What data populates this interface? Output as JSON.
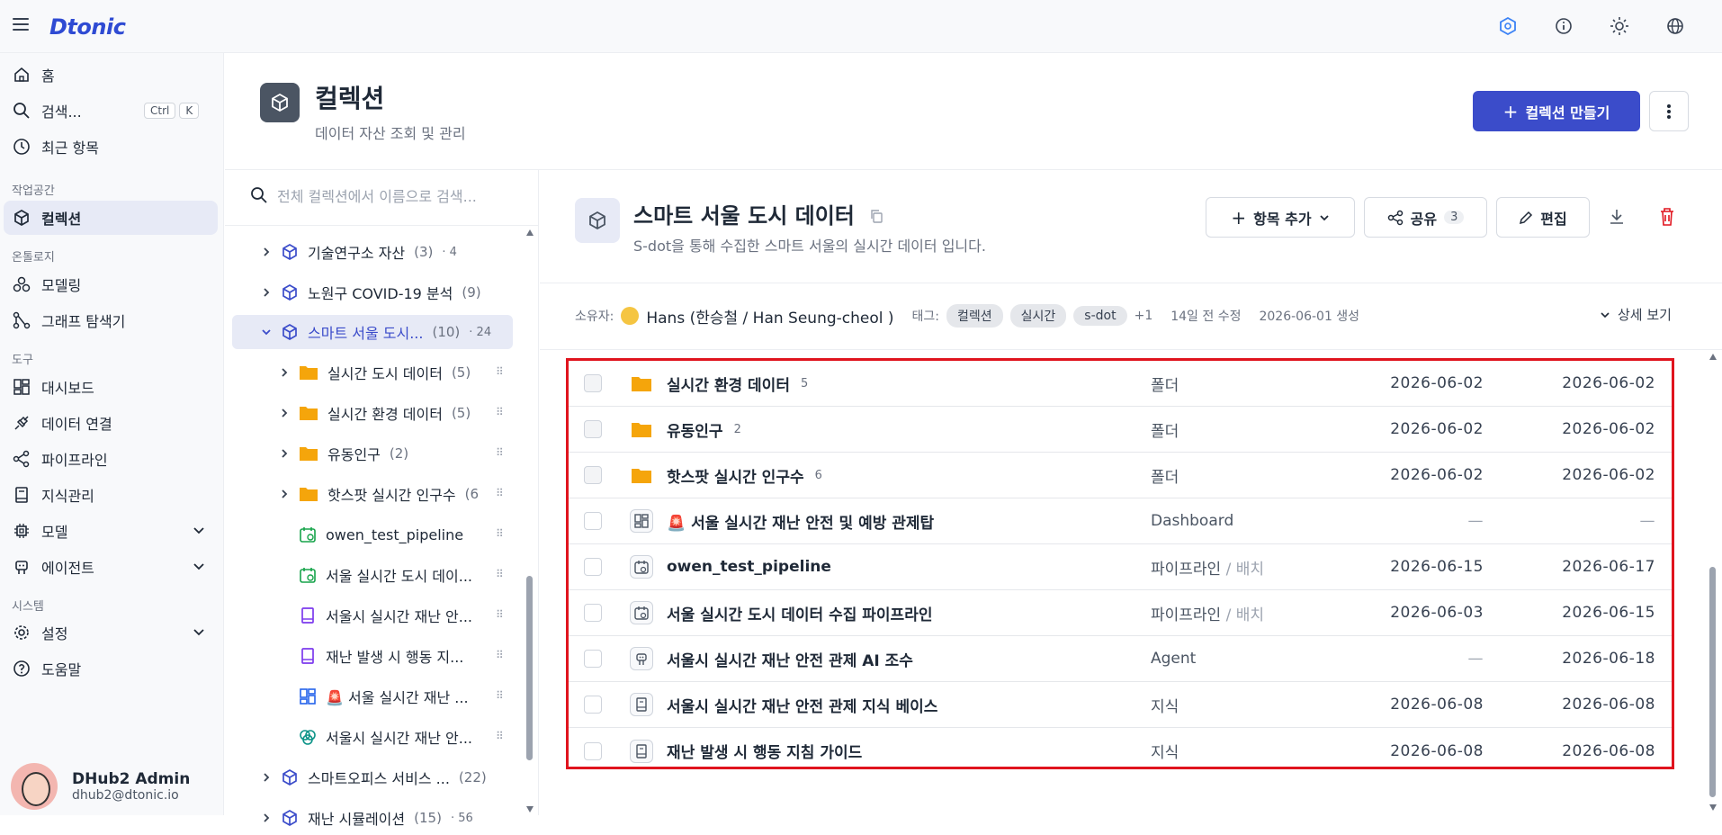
{
  "app": {
    "logo": "Dtonic"
  },
  "sidebar": {
    "home": "홈",
    "search": "검색...",
    "kbd_ctrl": "Ctrl",
    "kbd_k": "K",
    "recent": "최근 항목",
    "sections": {
      "workspace": "작업공간",
      "ontology": "온톨로지",
      "tools": "도구",
      "system": "시스템"
    },
    "collections": "컬렉션",
    "modeling": "모델링",
    "graph": "그래프 탐색기",
    "dashboard": "대시보드",
    "data_connect": "데이터 연결",
    "pipeline": "파이프라인",
    "knowledge": "지식관리",
    "model": "모델",
    "agent": "에이전트",
    "settings": "설정",
    "help": "도움말",
    "user": {
      "name": "DHub2 Admin",
      "email": "dhub2@dtonic.io"
    }
  },
  "header": {
    "title": "컬렉션",
    "subtitle": "데이터 자산 조회 및 관리",
    "create_button": "컬렉션 만들기"
  },
  "tree": {
    "search_placeholder": "전체 컬렉션에서 이름으로 검색...",
    "items": [
      {
        "label": "기술연구소 자산",
        "count": "(3)",
        "extra": "· 4"
      },
      {
        "label": "노원구 COVID-19 분석",
        "count": "(9)",
        "extra": ""
      },
      {
        "label": "스마트 서울 도시...",
        "count": "(10)",
        "extra": "· 24"
      },
      {
        "label": "실시간 도시 데이터",
        "count": "(5)"
      },
      {
        "label": "실시간 환경 데이터",
        "count": "(5)"
      },
      {
        "label": "유동인구",
        "count": "(2)"
      },
      {
        "label": "핫스팟 실시간 인구수",
        "count": "(6"
      },
      {
        "label": "owen_test_pipeline"
      },
      {
        "label": "서울 실시간 도시 데이..."
      },
      {
        "label": "서울시 실시간 재난 안..."
      },
      {
        "label": "재난 발생 시 행동 지..."
      },
      {
        "label": "🚨 서울 실시간 재난 ..."
      },
      {
        "label": "서울시 실시간 재난 안..."
      },
      {
        "label": "스마트오피스 서비스 ...",
        "count": "(22)"
      },
      {
        "label": "재난 시뮬레이션",
        "count": "(15)",
        "extra": "· 56"
      }
    ]
  },
  "collection": {
    "title": "스마트 서울 도시 데이터",
    "description": "S-dot을 통해 수집한 스마트 서울의 실시간 데이터 입니다.",
    "add_item": "항목 추가",
    "share": "공유",
    "share_count": "3",
    "edit": "편집",
    "owner_label": "소유자:",
    "owner": "Hans (한승철 / Han Seung-cheol )",
    "tags_label": "태그:",
    "tags": [
      "컬렉션",
      "실시간",
      "s-dot"
    ],
    "tags_more": "+1",
    "modified": "14일 전 수정",
    "created": "2026-06-01 생성",
    "detail": "상세 보기"
  },
  "rows": [
    {
      "name": "실시간 환경 데이터",
      "count": "5",
      "type": "폴더",
      "sub": "",
      "d1": "2026-06-02",
      "d2": "2026-06-02",
      "icon": "folder-icon"
    },
    {
      "name": "유동인구",
      "count": "2",
      "type": "폴더",
      "sub": "",
      "d1": "2026-06-02",
      "d2": "2026-06-02",
      "icon": "folder-icon"
    },
    {
      "name": "핫스팟 실시간 인구수",
      "count": "6",
      "type": "폴더",
      "sub": "",
      "d1": "2026-06-02",
      "d2": "2026-06-02",
      "icon": "folder-icon"
    },
    {
      "name": "🚨 서울 실시간 재난 안전 및 예방 관제탑",
      "count": "",
      "type": "Dashboard",
      "sub": "",
      "d1": "—",
      "d2": "—",
      "icon": "dashboard-icon"
    },
    {
      "name": "owen_test_pipeline",
      "count": "",
      "type": "파이프라인",
      "sub": "배치",
      "d1": "2026-06-15",
      "d2": "2026-06-17",
      "icon": "pipeline-icon"
    },
    {
      "name": "서울 실시간 도시 데이터 수집 파이프라인",
      "count": "",
      "type": "파이프라인",
      "sub": "배치",
      "d1": "2026-06-03",
      "d2": "2026-06-15",
      "icon": "pipeline-icon"
    },
    {
      "name": "서울시 실시간 재난 안전 관제 AI 조수",
      "count": "",
      "type": "Agent",
      "sub": "",
      "d1": "—",
      "d2": "2026-06-18",
      "icon": "agent-icon"
    },
    {
      "name": "서울시 실시간 재난 안전 관제 지식 베이스",
      "count": "",
      "type": "지식",
      "sub": "",
      "d1": "2026-06-08",
      "d2": "2026-06-08",
      "icon": "knowledge-icon"
    },
    {
      "name": "재난 발생 시 행동 지침 가이드",
      "count": "",
      "type": "지식",
      "sub": "",
      "d1": "2026-06-08",
      "d2": "2026-06-08",
      "icon": "knowledge-icon"
    }
  ],
  "colors": {
    "accent": "#3b4cca",
    "folder": "#f5a50b",
    "highlight": "#e0141e"
  }
}
